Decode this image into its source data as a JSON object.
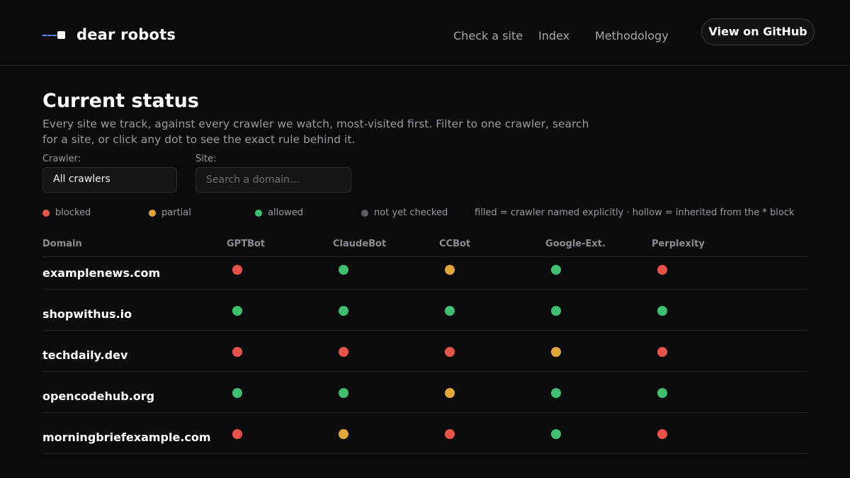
{
  "header": {
    "brand": "dear robots",
    "nav": [
      "Check a site",
      "Index",
      "Methodology"
    ],
    "github_label": "View on GitHub",
    "logo": "dashed-line-square-icon"
  },
  "main": {
    "title": "Current status",
    "description": "Every site we track, against every crawler we watch, most-visited first. Filter to one crawler, search for a site, or click any dot to see the exact rule behind it.",
    "crawler_label": "Crawler:",
    "crawler_value": "All crawlers",
    "site_label": "Site:",
    "site_placeholder": "Search a domain…"
  },
  "legend": {
    "items": [
      {
        "label": "blocked",
        "color": "#e5534b"
      },
      {
        "label": "partial",
        "color": "#e3a63a"
      },
      {
        "label": "allowed",
        "color": "#3fbf6f"
      },
      {
        "label": "not yet checked",
        "color": "#5d5d63"
      }
    ],
    "note": "filled = crawler named explicitly  ·  hollow = inherited from the * block"
  },
  "table": {
    "columns": [
      "Domain",
      "GPTBot",
      "ClaudeBot",
      "CCBot",
      "Google-Ext.",
      "Perplexity"
    ],
    "rows": [
      {
        "domain": "examplenews.com",
        "statuses": [
          "blocked",
          "allowed",
          "partial",
          "allowed",
          "blocked"
        ]
      },
      {
        "domain": "shopwithus.io",
        "statuses": [
          "allowed",
          "allowed",
          "allowed",
          "allowed",
          "allowed"
        ]
      },
      {
        "domain": "techdaily.dev",
        "statuses": [
          "blocked",
          "blocked",
          "blocked",
          "partial",
          "blocked"
        ]
      },
      {
        "domain": "opencodehub.org",
        "statuses": [
          "allowed",
          "allowed",
          "partial",
          "allowed",
          "allowed"
        ]
      },
      {
        "domain": "morningbriefexample.com",
        "statuses": [
          "blocked",
          "partial",
          "blocked",
          "allowed",
          "blocked"
        ]
      }
    ]
  },
  "colors": {
    "blocked": "#e5534b",
    "partial": "#e3a63a",
    "allowed": "#3fbf6f",
    "unchecked": "#5d5d63",
    "accent": "#4f8cf7"
  }
}
